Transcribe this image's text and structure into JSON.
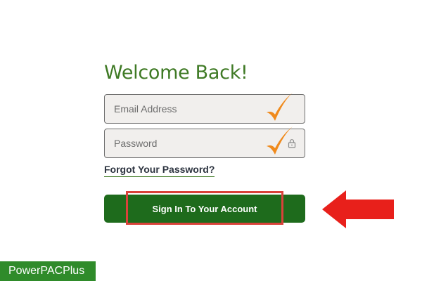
{
  "login": {
    "title": "Welcome Back!",
    "email_placeholder": "Email Address",
    "email_value": "",
    "password_placeholder": "Password",
    "password_value": "",
    "forgot_password_label": "Forgot Your Password?",
    "sign_in_label": "Sign In To Your Account"
  },
  "annotations": {
    "email_check": "checkmark-icon",
    "password_check": "checkmark-icon",
    "highlight_color": "#d9423a",
    "arrow_color": "#e8201b",
    "arrow_icon": "left-arrow-icon",
    "checkmark_color": "#f08a1c"
  },
  "branding": {
    "label": "PowerPACPlus",
    "color": "#2f8b2a"
  },
  "colors": {
    "accent_green": "#3f7a25",
    "button_green": "#1e6b1c",
    "field_bg": "#f1efed"
  },
  "icons": {
    "password_field": "lock-icon"
  }
}
